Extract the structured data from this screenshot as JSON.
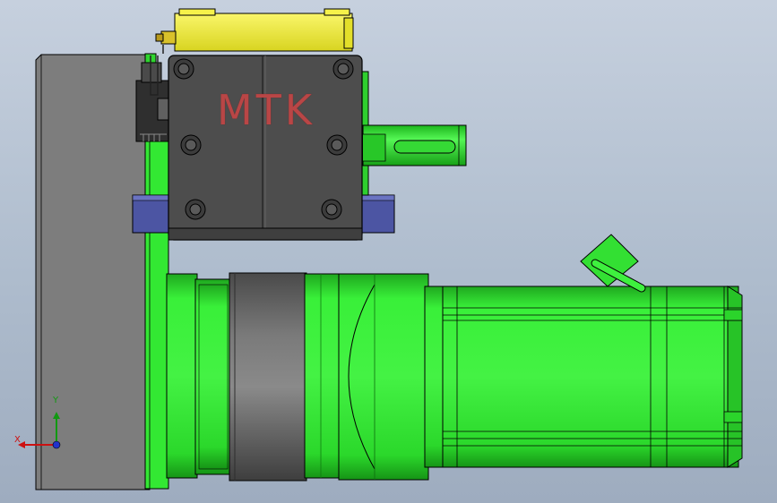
{
  "viewport": {
    "brand_text": "MTK",
    "triad": {
      "x_label": "X",
      "y_label": "Y"
    }
  },
  "colors": {
    "background_top": "#c6d0de",
    "background_bottom": "#9eacbf",
    "plate": "#7f7f7f",
    "motor_green": "#33ee33",
    "gearbox_dark": "#5a5a5a",
    "connector_yellow": "#f2ef3a",
    "clamp_blue": "#4c55a3",
    "brand_text": "#b94646"
  }
}
